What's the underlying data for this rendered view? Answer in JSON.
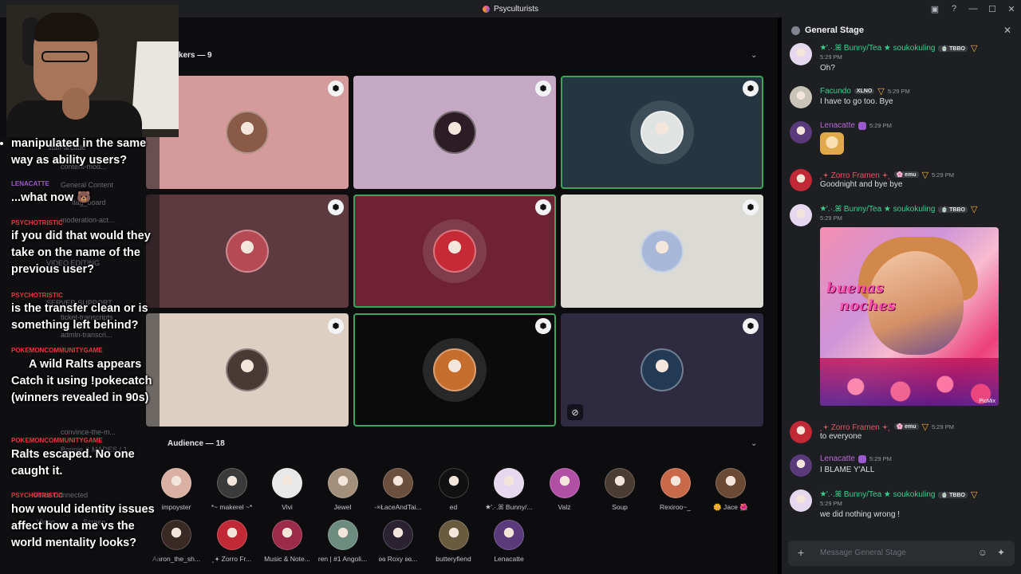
{
  "window": {
    "title": "Psyculturists",
    "controls": [
      "▣",
      "?",
      "—",
      "☐",
      "✕"
    ]
  },
  "stage": {
    "speakers_label": "Speakers — 9",
    "audience_label": "Audience — 18",
    "speakers": [
      {
        "bg": "#d59a9a",
        "avatar": "#8a5a48",
        "speaking": false
      },
      {
        "bg": "#c4a8c4",
        "avatar": "#2b1c26",
        "speaking": false
      },
      {
        "bg": "#233641",
        "avatar": "#dfe4e2",
        "speaking": true
      },
      {
        "bg": "#5c3a3f",
        "avatar": "#b54a55",
        "speaking": false
      },
      {
        "bg": "#6e2233",
        "avatar": "#c52a36",
        "speaking": true
      },
      {
        "bg": "#dcdad5",
        "avatar": "#a8b8d8",
        "speaking": false
      },
      {
        "bg": "#ddd0c3",
        "avatar": "#4a3a36",
        "speaking": false
      },
      {
        "bg": "#0b0b0c",
        "avatar": "#c56d2c",
        "speaking": true
      },
      {
        "bg": "#2e2a40",
        "avatar": "#233a55",
        "speaking": false
      }
    ],
    "audience": [
      {
        "name": "impoyster",
        "color": "#d9b0a2"
      },
      {
        "name": "*~ makerel ~*",
        "color": "#3a3a3a"
      },
      {
        "name": "Vivi",
        "color": "#e8e8e8"
      },
      {
        "name": "Jewel",
        "color": "#a38f7a"
      },
      {
        "name": "-×ŁaceAndTai...",
        "color": "#6a4e3e"
      },
      {
        "name": "ed",
        "color": "#111111"
      },
      {
        "name": "★'.·.ꕤ Bunny/...",
        "color": "#e6d9ef"
      },
      {
        "name": "Valz",
        "color": "#b14fa5"
      },
      {
        "name": "Soup",
        "color": "#4a3c30"
      },
      {
        "name": "Rexiroo~_",
        "color": "#c86a4a"
      },
      {
        "name": "🌼 Jace 🌺",
        "color": "#6b4a35"
      },
      {
        "name": "Aaron_the_sh...",
        "color": "#3a2a26"
      },
      {
        "name": "˛𖥔 Zorro Fr...",
        "color": "#c02935"
      },
      {
        "name": "Music & Note...",
        "color": "#9c2a4a"
      },
      {
        "name": "ren | #1 Angoli...",
        "color": "#6d8c80"
      },
      {
        "name": "ʚɞ Roxy ʚɞ...",
        "color": "#2a2230"
      },
      {
        "name": "butteryfiend",
        "color": "#6a5a3e"
      },
      {
        "name": "Lenacatte",
        "color": "#5a3a7a"
      }
    ]
  },
  "overlay": {
    "messages": [
      "manipulated in the same way as ability users?",
      "...what now 🐻",
      "if you did that would they take on the name of the previous user?",
      "is the transfer clean or is something left behind?",
      "A wild Ralts appears Catch it using !pokecatch (winners revealed in 90s)",
      "Ralts escaped. No one caught it.",
      "how would identity issues affect how a me vs the world mentality looks?"
    ],
    "names": [
      "LENACATTE",
      "PSYCHOTRISTIC",
      "PSYCHOTRISTIC",
      "POKEMONCOMMUNITYGAME",
      "POKEMONCOMMUNITYGAME",
      "PSYCHOTRISTIC"
    ],
    "faint": [
      "staff-arcade",
      "content-mod...",
      "General Content",
      "flag_board",
      "moderation-act...",
      "VIDEO EDITING",
      "SERVER SUPPORT",
      "ticket-transcripts",
      "admin-transcri...",
      "general",
      "convince-the-m...",
      "Bonnie & MADES / 1...",
      "Voice Connected",
      "Video",
      "Screen"
    ]
  },
  "panel": {
    "title": "General Stage",
    "composer_placeholder": "Message General Stage",
    "messages": [
      {
        "name": "★'.·.ꕤ Bunny/Tea ★ soukokuling",
        "name_color": "#3ecf8e",
        "tag": "🍵 TBBO",
        "time": "5:29 PM",
        "time_below": true,
        "body": "Oh?",
        "avatar": "#e6d9ef"
      },
      {
        "name": "Facundo",
        "name_color": "#3ecf8e",
        "tag": "XLNO",
        "time": "5:29 PM",
        "time_below": false,
        "body": "I have to go too. Bye",
        "avatar": "#c9c4b8"
      },
      {
        "name": "Lenacatte",
        "name_color": "#b86ad8",
        "tag": "",
        "time": "5:29 PM",
        "time_below": false,
        "body": "",
        "avatar": "#5a3a7a"
      },
      {
        "name": "˛𖥔 Zorro Framen 𖥔˛",
        "name_color": "#e05a64",
        "tag": "🌸 emu",
        "time": "5:29 PM",
        "time_below": false,
        "body": "Goodnight and bye bye",
        "avatar": "#c02935"
      },
      {
        "name": "★'.·.ꕤ Bunny/Tea ★ soukokuling",
        "name_color": "#3ecf8e",
        "tag": "🍵 TBBO",
        "time": "5:29 PM",
        "time_below": true,
        "body": "",
        "avatar": "#e6d9ef"
      },
      {
        "name": "˛𖥔 Zorro Framen 𖥔˛",
        "name_color": "#e05a64",
        "tag": "🌸 emu",
        "time": "5:29 PM",
        "time_below": false,
        "body": "to everyone",
        "avatar": "#c02935"
      },
      {
        "name": "Lenacatte",
        "name_color": "#b86ad8",
        "tag": "",
        "time": "5:29 PM",
        "time_below": false,
        "body": "I BLAME Y'ALL",
        "avatar": "#5a3a7a"
      },
      {
        "name": "★'.·.ꕤ Bunny/Tea ★ soukokuling",
        "name_color": "#3ecf8e",
        "tag": "🍵 TBBO",
        "time": "5:29 PM",
        "time_below": true,
        "body": "we did nothing wrong !",
        "avatar": "#e6d9ef"
      }
    ],
    "gif_text_1": "buenas",
    "gif_text_2": "noches",
    "gif_watermark": "PicMix"
  }
}
